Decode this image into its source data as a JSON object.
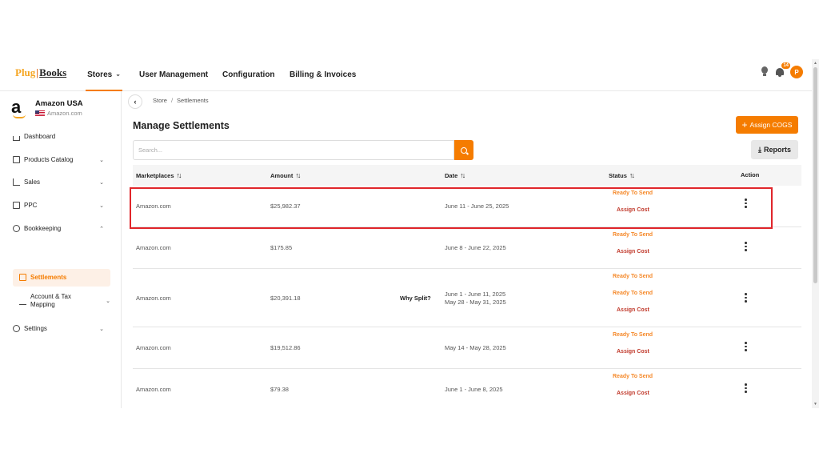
{
  "header": {
    "logo_plug": "Plug",
    "logo_books": "Books",
    "nav": [
      {
        "label": "Stores"
      },
      {
        "label": "User Management"
      },
      {
        "label": "Configuration"
      },
      {
        "label": "Billing & Invoices"
      }
    ],
    "notification_count": "14",
    "avatar_initial": "P"
  },
  "sidebar": {
    "store_name": "Amazon USA",
    "store_domain": "Amazon.com",
    "items": [
      {
        "label": "Dashboard",
        "icon": "home-icon"
      },
      {
        "label": "Products Catalog",
        "icon": "box-icon"
      },
      {
        "label": "Sales",
        "icon": "chart-icon"
      },
      {
        "label": "PPC",
        "icon": "ppc-icon"
      },
      {
        "label": "Bookkeeping",
        "icon": "bookkeeping-icon"
      },
      {
        "label": "Settlements",
        "icon": "settlements-icon"
      },
      {
        "label": "Account & Tax Mapping",
        "icon": "account-icon"
      },
      {
        "label": "Settings",
        "icon": "gear-icon"
      }
    ]
  },
  "breadcrumb": {
    "root": "Store",
    "current": "Settlements"
  },
  "page": {
    "title": "Manage Settlements",
    "assign_cogs_label": "Assign COGS",
    "search_placeholder": "Search...",
    "reports_label": "Reports"
  },
  "table": {
    "columns": [
      "Marketplaces",
      "Amount",
      "Date",
      "Status",
      "Action"
    ],
    "rows": [
      {
        "marketplace": "Amazon.com",
        "amount": "$25,982.37",
        "date": "June 11 - June 25, 2025",
        "status": "Ready To Send",
        "action": "Assign Cost"
      },
      {
        "marketplace": "Amazon.com",
        "amount": "$175.85",
        "date": "June 8 - June 22, 2025",
        "status": "Ready To Send",
        "action": "Assign Cost"
      },
      {
        "marketplace": "Amazon.com",
        "amount": "$20,391.18",
        "why": "Why Split?",
        "date": "June 1 - June 11, 2025",
        "date2": "May 28 - May 31, 2025",
        "status": "Ready To Send",
        "status2": "Ready To Send",
        "action": "Assign Cost"
      },
      {
        "marketplace": "Amazon.com",
        "amount": "$19,512.86",
        "date": "May 14 - May 28, 2025",
        "status": "Ready To Send",
        "action": "Assign Cost"
      },
      {
        "marketplace": "Amazon.com",
        "amount": "$79.38",
        "date": "June 1 - June 8, 2025",
        "status": "Ready To Send",
        "action": "Assign Cost"
      }
    ]
  },
  "colors": {
    "accent": "#f57c00",
    "highlight": "#e0262b",
    "assign": "#c0392b"
  }
}
